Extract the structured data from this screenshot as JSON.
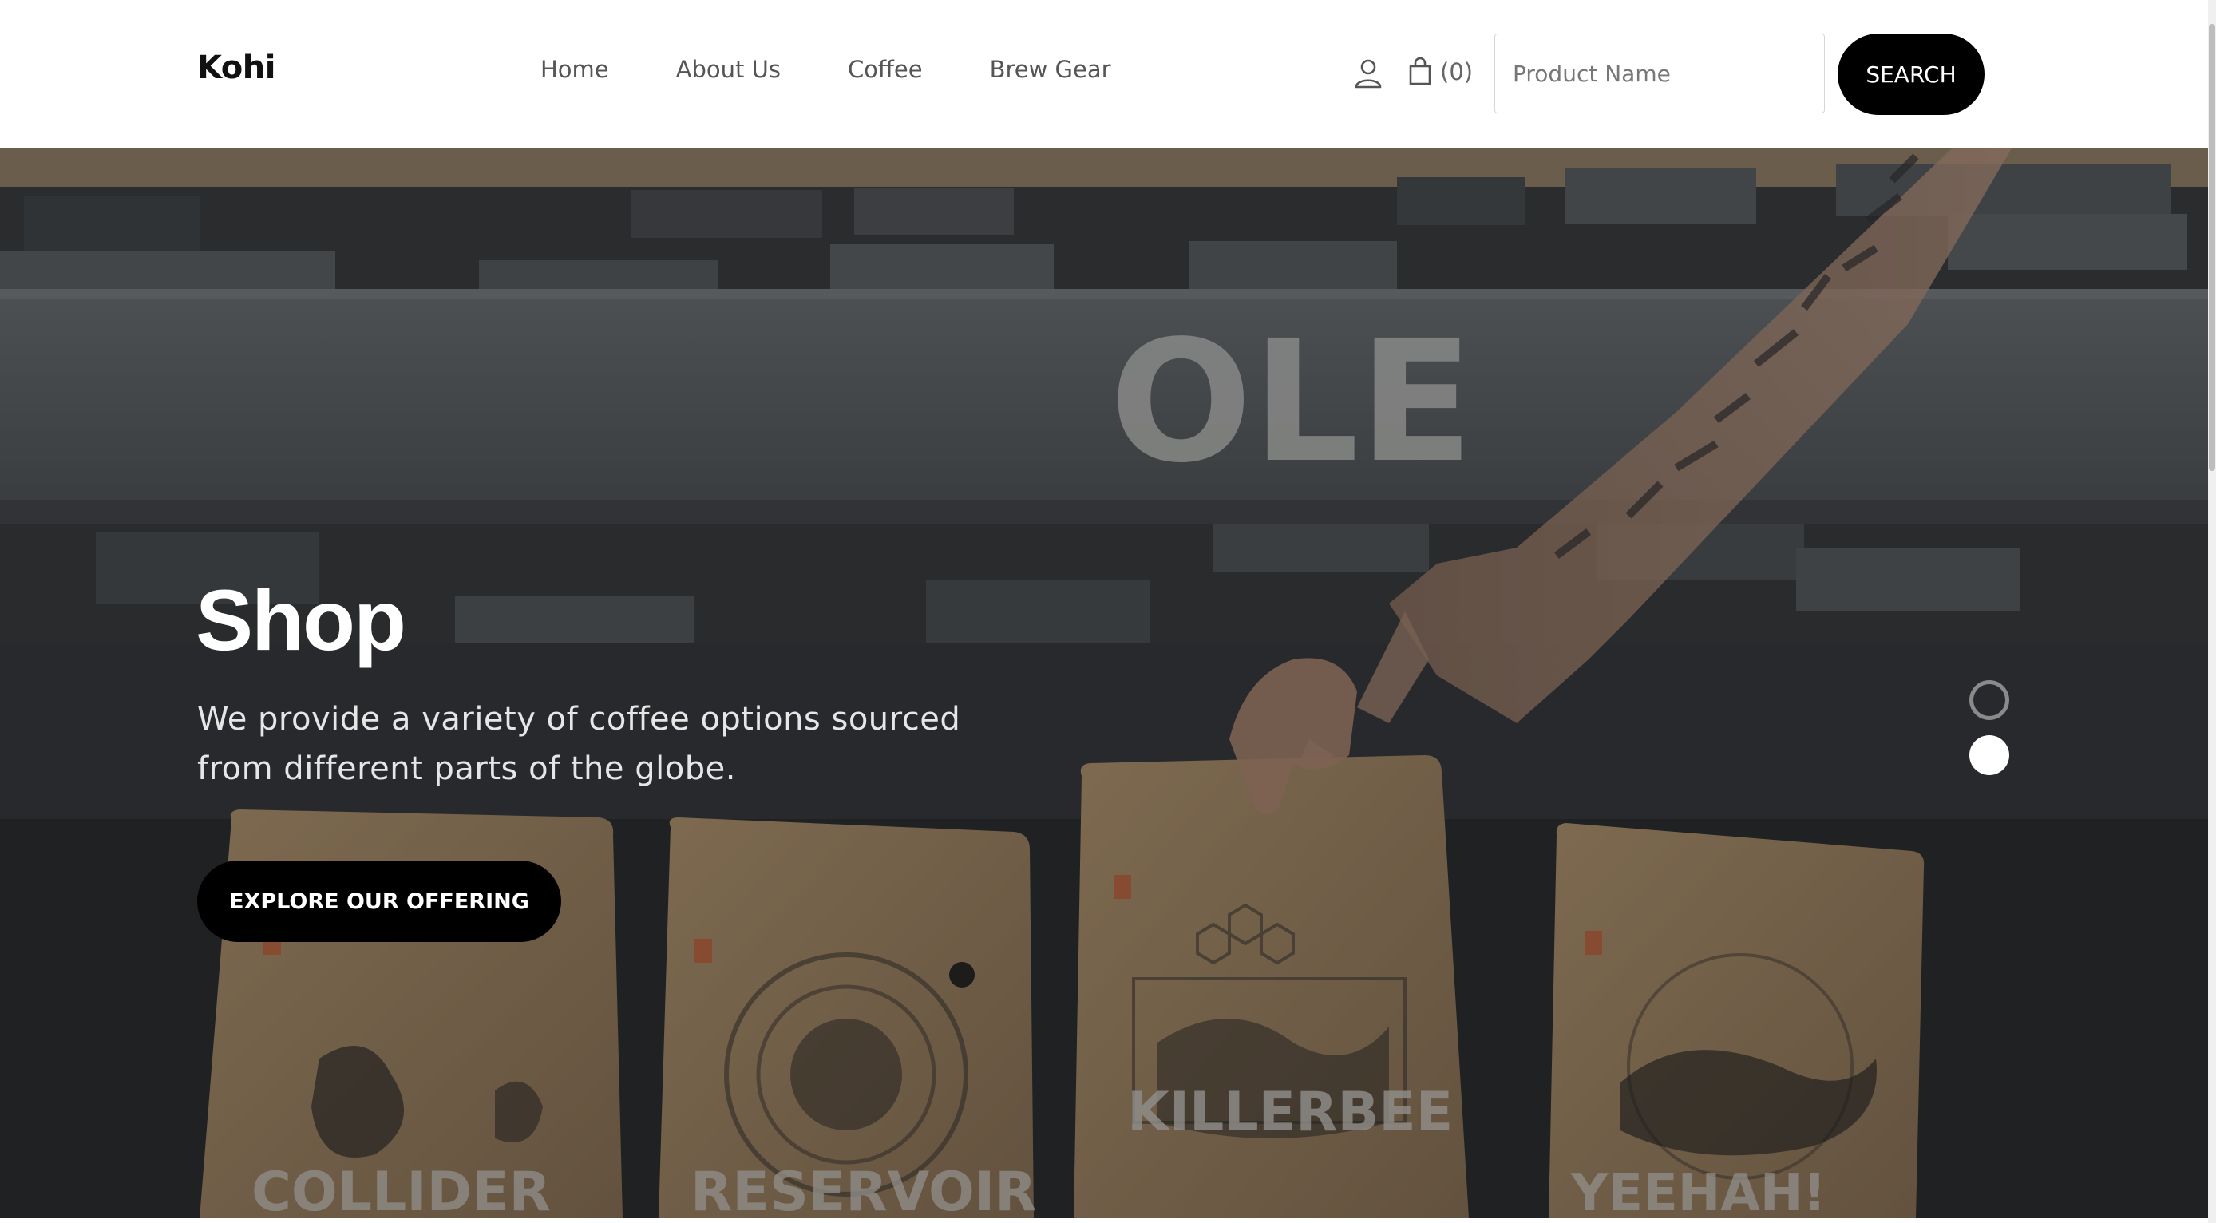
{
  "header": {
    "logo": "Kohi",
    "nav": [
      "Home",
      "About Us",
      "Coffee",
      "Brew Gear"
    ],
    "cart_count": "(0)",
    "search_placeholder": "Product Name",
    "search_button": "SEARCH",
    "icons": {
      "account": "user-icon",
      "cart": "shopping-bag-icon"
    }
  },
  "hero": {
    "title": "Shop",
    "subtitle": "We provide a variety of coffee options sourced from different parts of the globe.",
    "cta": "EXPLORE OUR OFFERING",
    "bag_labels": [
      "COLLIDER",
      "RESERVOIR",
      "KILLERBEE",
      "YEEHAH!"
    ],
    "wall_stencil": "OLE",
    "carousel": {
      "slides": 2,
      "active": 2
    }
  },
  "colors": {
    "header_bg": "#ffffff",
    "button": "#000000",
    "hero_overlay": "#1e1f21",
    "kraft": "#b5936a"
  }
}
